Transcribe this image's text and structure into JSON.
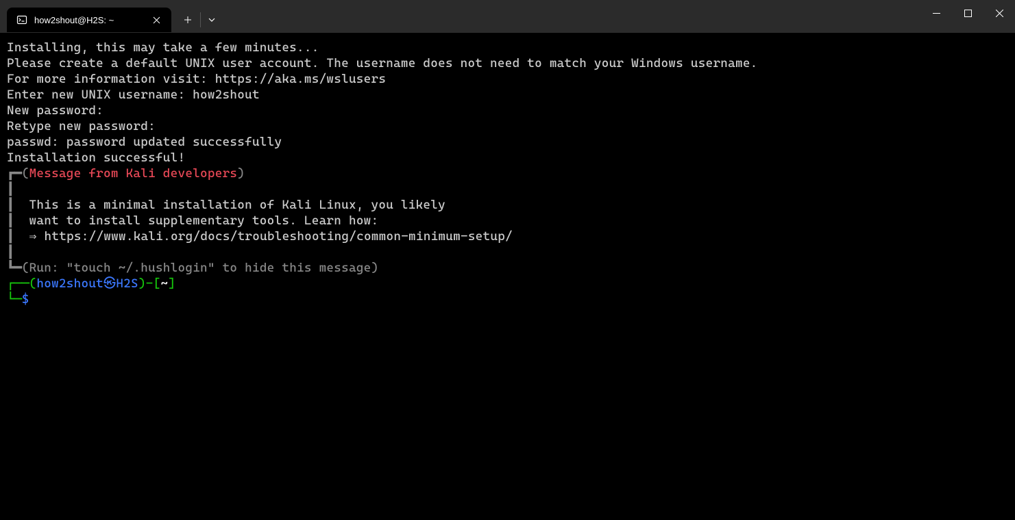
{
  "titlebar": {
    "tab_title": "how2shout@H2S: ~"
  },
  "terminal": {
    "lines": {
      "l1": "Installing, this may take a few minutes...",
      "l2": "Please create a default UNIX user account. The username does not need to match your Windows username.",
      "l3": "For more information visit: https://aka.ms/wslusers",
      "l4": "Enter new UNIX username: how2shout",
      "l5": "New password:",
      "l6": "Retype new password:",
      "l7": "passwd: password updated successfully",
      "l8": "Installation successful!"
    },
    "box": {
      "top_corner": "┏━",
      "top_paren_open": "(",
      "header": "Message from Kali developers",
      "top_paren_close": ")",
      "side": "┃",
      "msg1": "  This is a minimal installation of Kali Linux, you likely",
      "msg2": "  want to install supplementary tools. Learn how:",
      "msg3_arrow": "  ⇒ ",
      "msg3_url": "https://www.kali.org/docs/troubleshooting/common-minimum-setup/",
      "bottom_corner": "┗━",
      "bottom_paren_open": "(",
      "footer": "Run: \"touch ~/.hushlogin\" to hide this message",
      "bottom_paren_close": ")"
    },
    "prompt": {
      "top_corner": "┌──",
      "paren_open": "(",
      "user": "how2shout",
      "skull": "㉿",
      "host": "H2S",
      "paren_close": ")",
      "dash": "-",
      "bracket_open": "[",
      "path": "~",
      "bracket_close": "]",
      "bottom_corner": "└─",
      "symbol": "$"
    }
  }
}
